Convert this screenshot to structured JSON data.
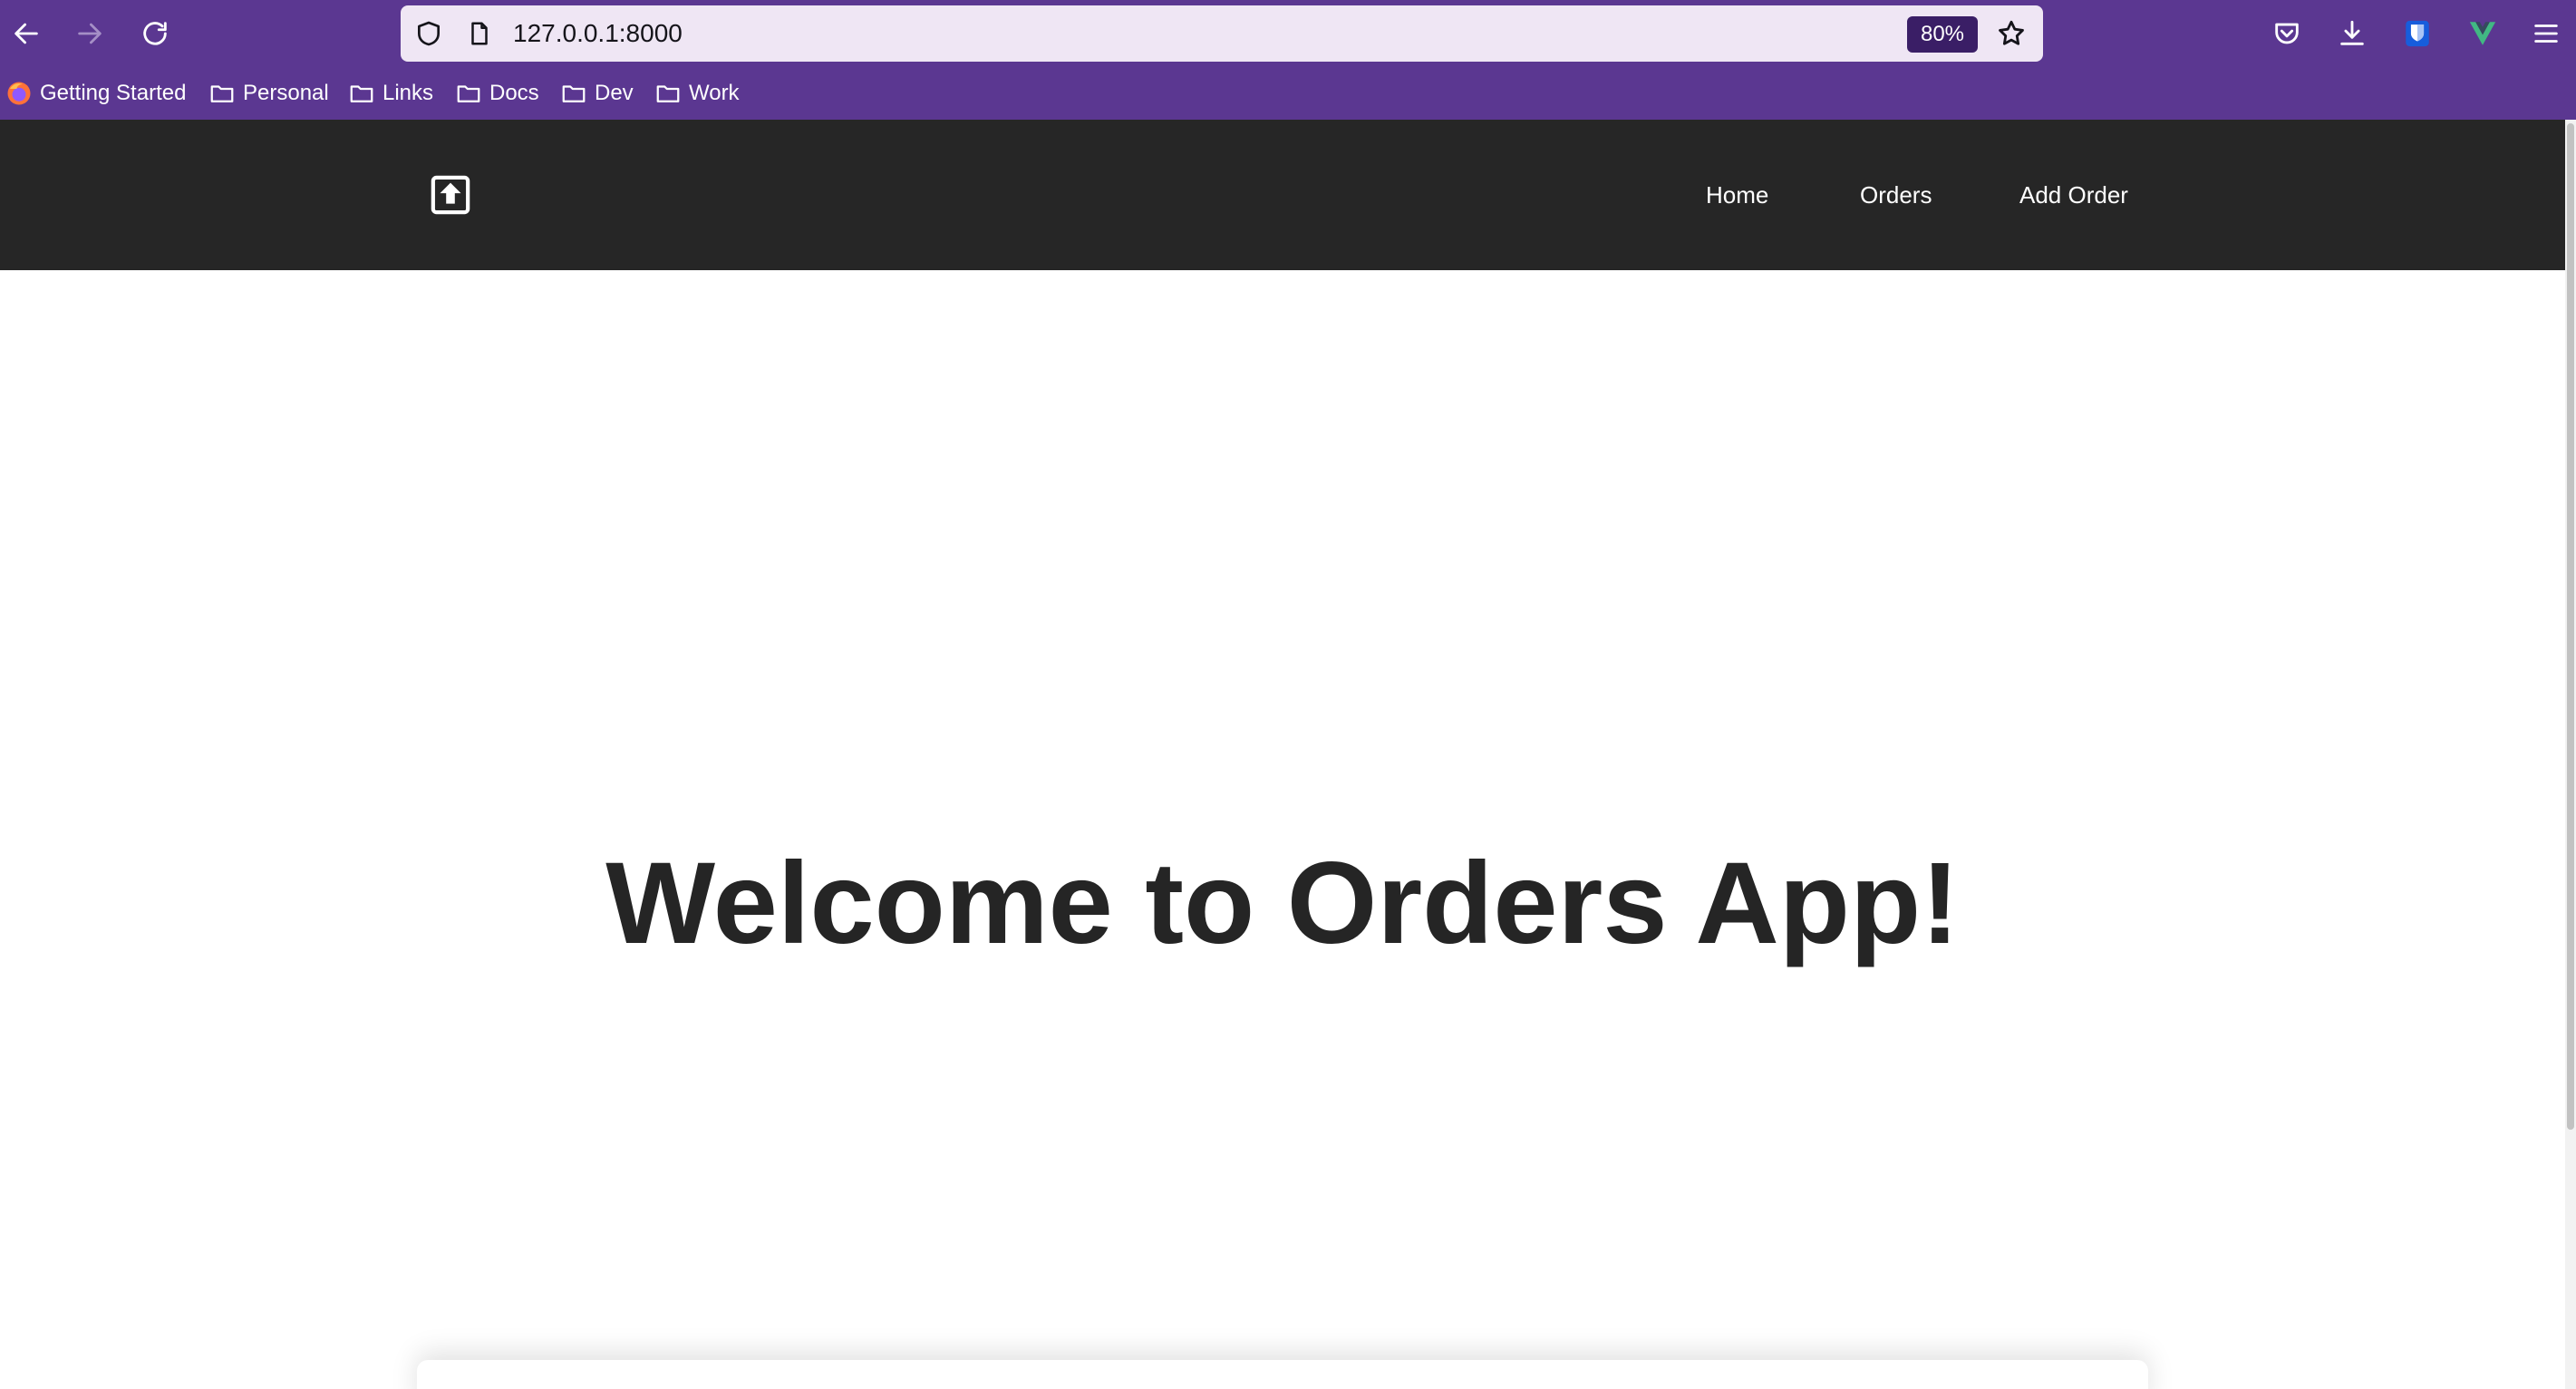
{
  "browser": {
    "url": "127.0.0.1:8000",
    "zoom": "80%",
    "bookmarks": [
      {
        "label": "Getting Started",
        "icon": "firefox-icon"
      },
      {
        "label": "Personal",
        "icon": "folder-icon"
      },
      {
        "label": "Links",
        "icon": "folder-icon"
      },
      {
        "label": "Docs",
        "icon": "folder-icon"
      },
      {
        "label": "Dev",
        "icon": "folder-icon"
      },
      {
        "label": "Work",
        "icon": "folder-icon"
      }
    ],
    "colors": {
      "chrome": "#5b3791",
      "urlbar": "#efe6f4",
      "zoom_badge": "#3a1e66"
    }
  },
  "site": {
    "nav": {
      "logo_icon": "upload-box-icon",
      "links": [
        "Home",
        "Orders",
        "Add Order"
      ]
    },
    "hero": {
      "title": "Welcome to Orders App!"
    },
    "colors": {
      "navbar": "#262626",
      "title": "#252525"
    }
  }
}
